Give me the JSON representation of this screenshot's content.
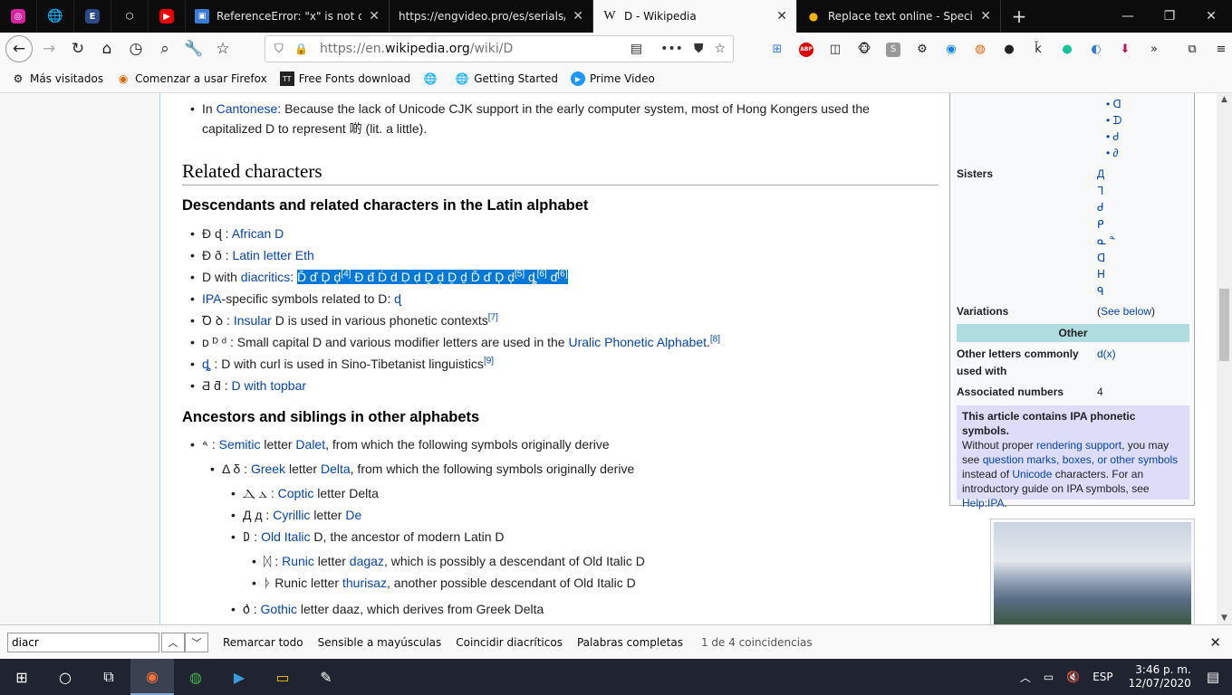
{
  "tabs": [
    {
      "title": "ReferenceError: \"x\" is not defined",
      "active": false
    },
    {
      "title": "https://engvideo.pro/es/serials/mr",
      "active": false
    },
    {
      "title": "D - Wikipedia",
      "active": true
    },
    {
      "title": "Replace text online - Special",
      "active": false
    }
  ],
  "url": {
    "prefix": "https://en.",
    "domain": "wikipedia.org",
    "path": "/wiki/D"
  },
  "bookmarks": [
    "Más visitados",
    "Comenzar a usar Firefox",
    "Free Fonts download",
    "Getting Started",
    "Prime Video"
  ],
  "article": {
    "cantonese": {
      "pre": "In ",
      "link": "Cantonese",
      "rest": ": Because the lack of Unicode CJK support in the early computer system, most of Hong Kongers used the",
      "line2": "capitalized D to represent 啲 (lit. a little)."
    },
    "section_title": "Related characters",
    "sub1": "Descendants and related characters in the Latin alphabet",
    "l1_text": "Ɖ ɖ : ",
    "l1_link": "African D",
    "l2_text": "Ð ð : ",
    "l2_link": "Latin letter Eth",
    "l3_text": "D with ",
    "l3_link": "diacritics",
    "l3_highlight": "Ď ď Ḑ ḑ",
    "l3_highlight2": "Đ đ Ḋ ḋ Ḍ ḍ Ḓ ḓ Ḏ ḏ Ď ď Ḑ ḑ",
    "l3_highlight3": "ȡ",
    "l3_highlight4": "ɗ",
    "l3_ref1": "[4]",
    "l3_ref2": "[5]",
    "l3_ref3": "[6]",
    "l3_ref4": "[6]",
    "l4_link": "IPA",
    "l4_text": "-specific symbols related to D: ",
    "l4_sym": "ɖ",
    "l5_text": "Ꝺ ꝺ : ",
    "l5_link": "Insular",
    "l5_rest": " D is used in various phonetic contexts",
    "l5_ref": "[7]",
    "l6_text": "ᴅ ᴰ ᵈ : Small capital D and various modifier letters are used in the ",
    "l6_link": "Uralic Phonetic Alphabet",
    "l6_ref": "[8]",
    "l7_sym": "ȡ",
    "l7_text": " : D with curl is used in Sino-Tibetanist linguistics",
    "l7_ref": "[9]",
    "l8_text": "Ƌ ƌ : ",
    "l8_link": "D with topbar",
    "sub2": "Ancestors and siblings in other alphabets",
    "a1_text": "𐤃 : ",
    "a1_link1": "Semitic",
    "a1_mid": " letter ",
    "a1_link2": "Dalet",
    "a1_rest": ", from which the following symbols originally derive",
    "a2_text": "Δ δ : ",
    "a2_link1": "Greek",
    "a2_mid": " letter ",
    "a2_link2": "Delta",
    "a2_rest": ", from which the following symbols originally derive",
    "a3_text": "Ⲇ ⲇ : ",
    "a3_link": "Coptic",
    "a3_rest": " letter Delta",
    "a4_text": "Д д : ",
    "a4_link": "Cyrillic",
    "a4_mid": " letter ",
    "a4_link2": "De",
    "a5_text": "𐌃 : ",
    "a5_link": "Old Italic",
    "a5_rest": " D, the ancestor of modern Latin D",
    "a6_text": "ᛞ : ",
    "a6_link": "Runic",
    "a6_mid": " letter ",
    "a6_link2": "dagaz",
    "a6_rest": ", which is possibly a descendant of Old Italic D",
    "a7_text": "ᚦ Runic letter ",
    "a7_link": "thurisaz",
    "a7_rest": ", another possible descendant of Old Italic D",
    "a8_text": "𐌳 : ",
    "a8_link": "Gothic",
    "a8_rest": " letter daaz, which derives from Greek Delta"
  },
  "infobox": {
    "top_items": [
      "ᗡ",
      "ᗪ",
      "Ꮷ",
      "∂"
    ],
    "sisters_label": "Sisters",
    "sisters": [
      "Д",
      "ᒣ",
      "ᑯ",
      "ᑭ",
      "ᓇ ᓐ",
      "ᗡ",
      "ᕼ",
      "ᑫ"
    ],
    "variations_label": "Variations",
    "variations_value": "(See below)",
    "other_head": "Other",
    "other_letters_label": "Other letters commonly used with",
    "other_letters_value": "d(x)",
    "assoc_label": "Associated numbers",
    "assoc_value": "4",
    "note_bold": "This article contains IPA phonetic symbols.",
    "note_text1": "Without proper ",
    "note_link1": "rendering support",
    "note_text2": ", you may see ",
    "note_link2": "question marks, boxes, or other symbols",
    "note_text3": " instead of ",
    "note_link3": "Unicode",
    "note_text4": " characters. For an introductory guide on IPA symbols, see ",
    "note_link4": "Help:IPA",
    "note_text5": "."
  },
  "findbar": {
    "query": "diacr",
    "opt1": "Remarcar todo",
    "opt2": "Sensible a mayúsculas",
    "opt3": "Coincidir diacríticos",
    "opt4": "Palabras completas",
    "status": "1 de 4 coincidencias"
  },
  "taskbar": {
    "lang": "ESP",
    "time": "3:46 p. m.",
    "date": "12/07/2020"
  }
}
